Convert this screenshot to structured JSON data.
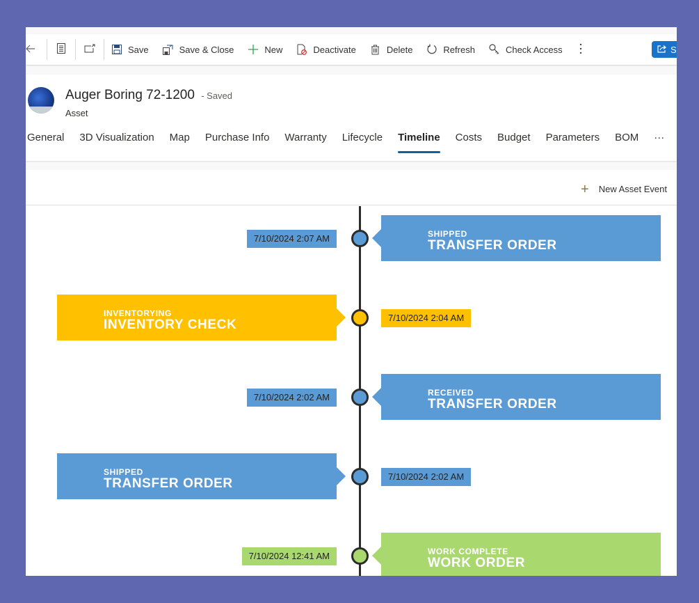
{
  "commandbar": {
    "back_icon": "arrow-left-icon",
    "items": [
      {
        "label": "Save",
        "icon": "save-icon"
      },
      {
        "label": "Save & Close",
        "icon": "save-close-icon"
      },
      {
        "label": "New",
        "icon": "plus-icon"
      },
      {
        "label": "Deactivate",
        "icon": "deactivate-icon"
      },
      {
        "label": "Delete",
        "icon": "trash-icon"
      },
      {
        "label": "Refresh",
        "icon": "refresh-icon"
      },
      {
        "label": "Check Access",
        "icon": "key-icon"
      }
    ],
    "more_icon": "more-vertical-icon",
    "share_label": "S"
  },
  "header": {
    "title": "Auger Boring 72-1200",
    "saved_status": "- Saved",
    "entity": "Asset"
  },
  "tabs": [
    {
      "label": "General"
    },
    {
      "label": "3D Visualization"
    },
    {
      "label": "Map"
    },
    {
      "label": "Purchase Info"
    },
    {
      "label": "Warranty"
    },
    {
      "label": "Lifecycle"
    },
    {
      "label": "Timeline",
      "active": true
    },
    {
      "label": "Costs"
    },
    {
      "label": "Budget"
    },
    {
      "label": "Parameters"
    },
    {
      "label": "BOM"
    },
    {
      "label": "···"
    }
  ],
  "timeline": {
    "new_event_label": "New Asset Event",
    "colors": {
      "blue": "#5b9bd5",
      "yellow": "#ffc000",
      "green": "#a9d86e"
    },
    "events": [
      {
        "status": "SHIPPED",
        "type": "TRANSFER ORDER",
        "date": "7/10/2024 2:07 AM",
        "color": "#5b9bd5",
        "side": "right"
      },
      {
        "status": "INVENTORYING",
        "type": "INVENTORY CHECK",
        "date": "7/10/2024 2:04 AM",
        "color": "#ffc000",
        "side": "left"
      },
      {
        "status": "RECEIVED",
        "type": "TRANSFER ORDER",
        "date": "7/10/2024 2:02 AM",
        "color": "#5b9bd5",
        "side": "right"
      },
      {
        "status": "SHIPPED",
        "type": "TRANSFER ORDER",
        "date": "7/10/2024 2:02 AM",
        "color": "#5b9bd5",
        "side": "left"
      },
      {
        "status": "WORK COMPLETE",
        "type": "WORK ORDER",
        "date": "7/10/2024 12:41 AM",
        "color": "#a9d86e",
        "side": "right"
      }
    ]
  }
}
